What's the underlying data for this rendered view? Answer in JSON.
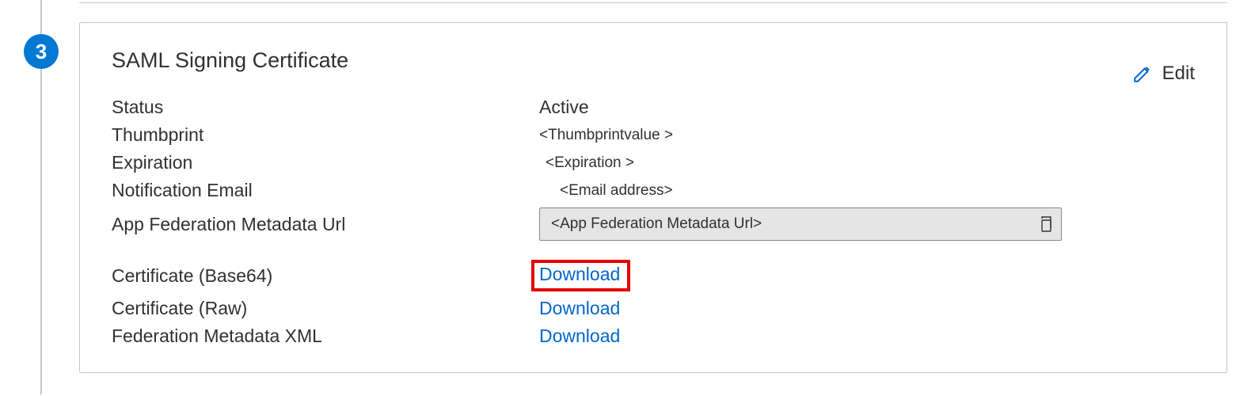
{
  "step": {
    "number": "3"
  },
  "card": {
    "title": "SAML Signing Certificate",
    "edit_label": "Edit",
    "fields": {
      "status_label": "Status",
      "status_value": "Active",
      "thumbprint_label": "Thumbprint",
      "thumbprint_value": "<Thumbprintvalue >",
      "expiration_label": "Expiration",
      "expiration_value": "<Expiration >",
      "notification_label": "Notification Email",
      "notification_value": "<Email address>",
      "metadata_url_label": "App Federation Metadata Url",
      "metadata_url_value": "<App Federation  Metadata Url>",
      "cert_base64_label": "Certificate (Base64)",
      "cert_base64_link": "Download",
      "cert_raw_label": "Certificate (Raw)",
      "cert_raw_link": "Download",
      "fed_xml_label": "Federation Metadata XML",
      "fed_xml_link": "Download"
    }
  }
}
